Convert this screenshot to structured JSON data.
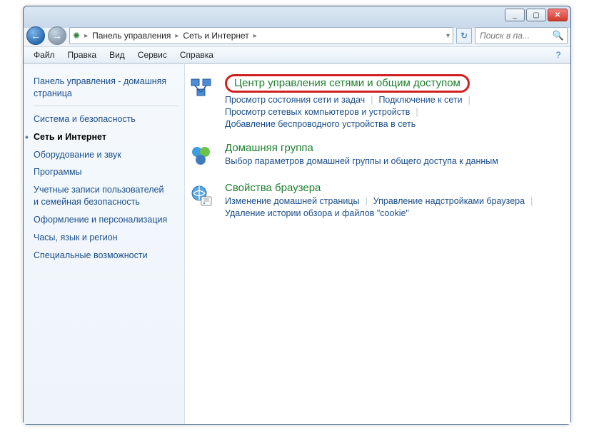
{
  "titlebar": {
    "min": "_",
    "max": "▢",
    "close": "✕"
  },
  "nav": {
    "breadcrumb": [
      "Панель управления",
      "Сеть и Интернет"
    ],
    "search_placeholder": "Поиск в па..."
  },
  "menu": [
    "Файл",
    "Правка",
    "Вид",
    "Сервис",
    "Справка"
  ],
  "sidebar": {
    "home": "Панель управления - домашняя страница",
    "items": [
      "Система и безопасность",
      "Сеть и Интернет",
      "Оборудование и звук",
      "Программы",
      "Учетные записи пользователей и семейная безопасность",
      "Оформление и персонализация",
      "Часы, язык и регион",
      "Специальные возможности"
    ],
    "active_index": 1
  },
  "content": {
    "groups": [
      {
        "title": "Центр управления сетями и общим доступом",
        "highlighted": true,
        "links": [
          [
            "Просмотр состояния сети и задач",
            "Подключение к сети"
          ],
          [
            "Просмотр сетевых компьютеров и устройств"
          ],
          [
            "Добавление беспроводного устройства в сеть"
          ]
        ]
      },
      {
        "title": "Домашняя группа",
        "highlighted": false,
        "links": [
          [
            "Выбор параметров домашней группы и общего доступа к данным"
          ]
        ]
      },
      {
        "title": "Свойства браузера",
        "highlighted": false,
        "links": [
          [
            "Изменение домашней страницы",
            "Управление надстройками браузера"
          ],
          [
            "Удаление истории обзора и файлов \"cookie\""
          ]
        ]
      }
    ]
  }
}
